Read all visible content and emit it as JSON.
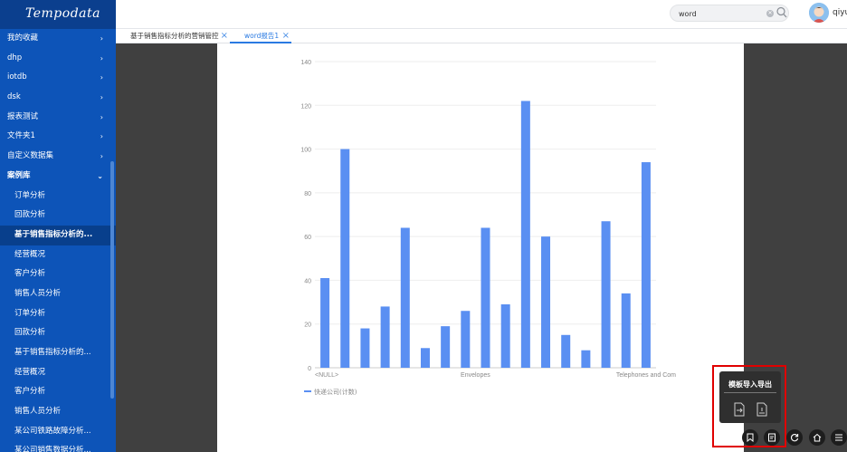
{
  "app": {
    "logo": "Tempodata"
  },
  "sidebar": {
    "items": [
      {
        "label": "我的收藏",
        "chevron": true
      },
      {
        "label": "dhp",
        "chevron": true
      },
      {
        "label": "iotdb",
        "chevron": true
      },
      {
        "label": "dsk",
        "chevron": true
      },
      {
        "label": "报表测试",
        "chevron": true
      },
      {
        "label": "文件夹1",
        "chevron": true
      },
      {
        "label": "自定义数据集",
        "chevron": true
      },
      {
        "label": "案例库",
        "chevron_down": true
      },
      {
        "label": "订单分析"
      },
      {
        "label": "回款分析"
      },
      {
        "label": "基于销售指标分析的..."
      },
      {
        "label": "经营概况"
      },
      {
        "label": "客户分析"
      },
      {
        "label": "销售人员分析"
      },
      {
        "label": "订单分析"
      },
      {
        "label": "回款分析"
      },
      {
        "label": "基于销售指标分析的..."
      },
      {
        "label": "经营概况"
      },
      {
        "label": "客户分析"
      },
      {
        "label": "销售人员分析"
      },
      {
        "label": "某公司铁路故障分析..."
      },
      {
        "label": "某公司销售数据分析..."
      }
    ]
  },
  "header": {
    "search": {
      "value": "word"
    },
    "user": {
      "name": "qiyu"
    }
  },
  "tabs": [
    {
      "label": "基于销售指标分析的营销管控"
    },
    {
      "label": "word报告1"
    }
  ],
  "chart_data": {
    "type": "bar",
    "title": "",
    "xlabel": "",
    "ylabel": "",
    "ylim": [
      0,
      140
    ],
    "yticks": [
      0,
      20,
      40,
      60,
      80,
      100,
      120,
      140
    ],
    "grid": true,
    "legend_position": "bottom-left",
    "color": "#5a8ff2",
    "category_labels": [
      "<NULL>",
      "Envelopes",
      "Telephones and Com"
    ],
    "series": [
      {
        "name": "快递公司(计数)",
        "values": [
          41,
          100,
          18,
          28,
          64,
          9,
          19,
          26,
          64,
          29,
          122,
          60,
          15,
          8,
          67,
          34,
          94
        ]
      }
    ]
  },
  "popup": {
    "title": "模板导入导出",
    "icons": [
      "import-template-icon",
      "export-template-icon"
    ]
  },
  "toolbar": {
    "icons": [
      "bookmark-icon",
      "template-icon",
      "refresh-icon",
      "home-icon",
      "menu-icon"
    ]
  }
}
